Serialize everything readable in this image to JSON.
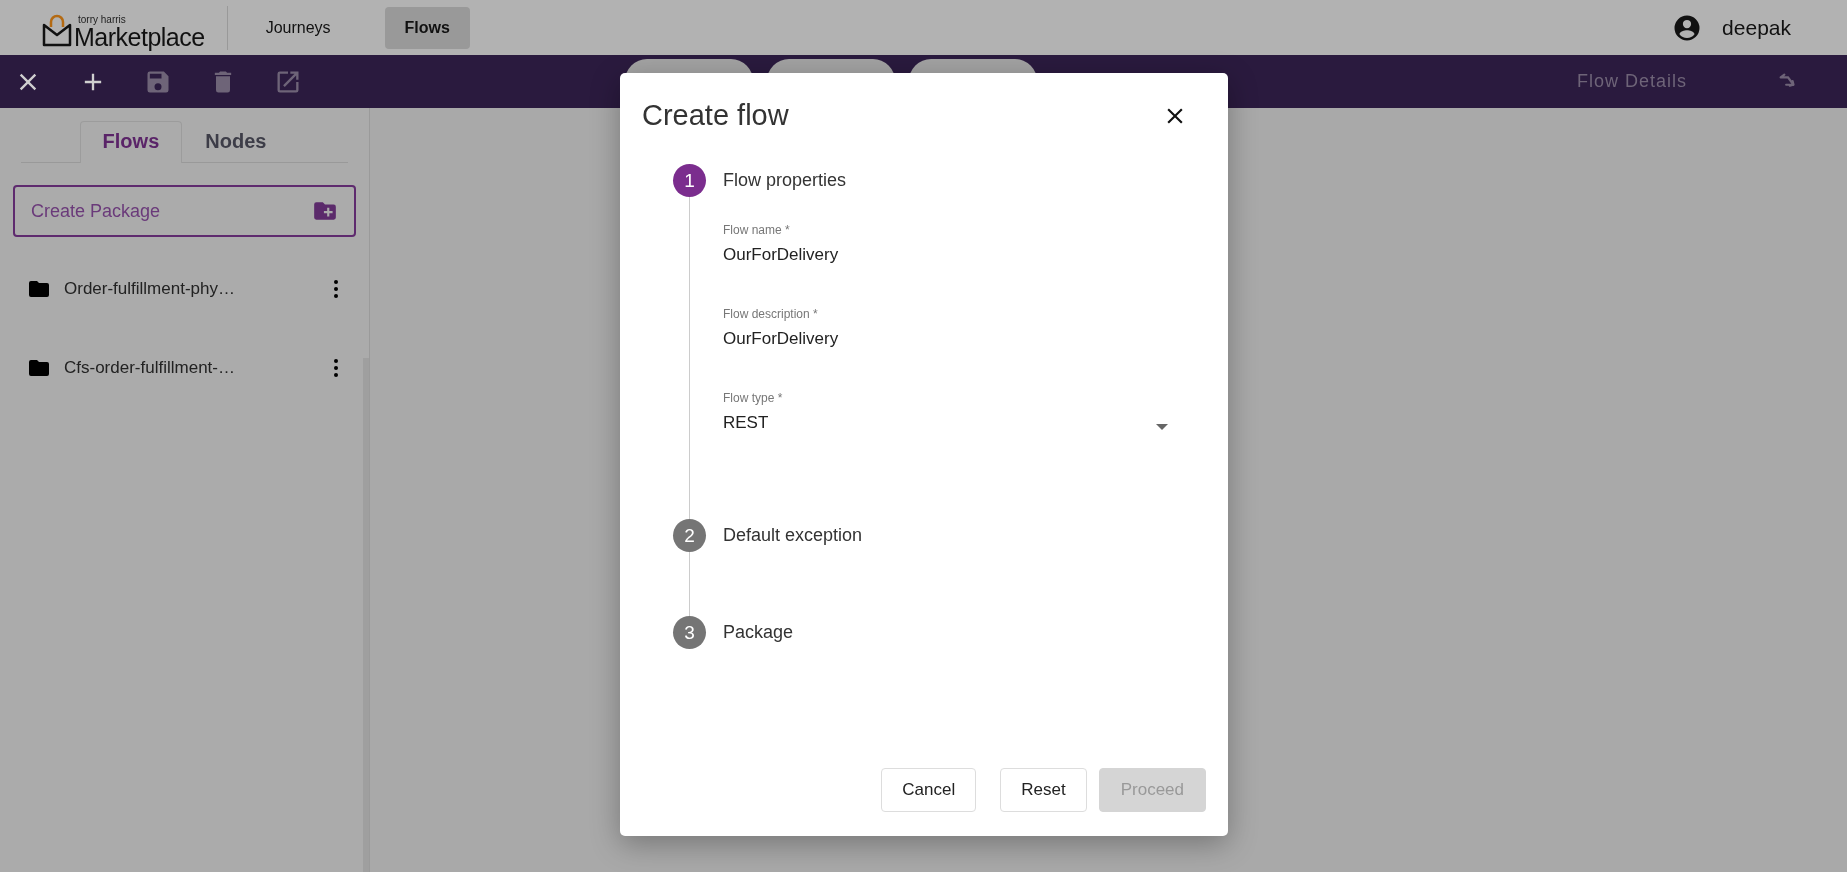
{
  "header": {
    "logo": {
      "tagline": "torry harris",
      "brand": "Marketplace"
    },
    "nav": [
      {
        "label": "Journeys",
        "selected": false
      },
      {
        "label": "Flows",
        "selected": true
      }
    ],
    "user": {
      "name": "deepak"
    }
  },
  "toolbar": {
    "actions": [
      {
        "kind": "close",
        "disabled": false
      },
      {
        "kind": "add",
        "disabled": false
      },
      {
        "kind": "save",
        "disabled": true
      },
      {
        "kind": "delete",
        "disabled": true
      },
      {
        "kind": "open",
        "disabled": true
      }
    ],
    "details_label": "Flow Details"
  },
  "sidebar": {
    "tabs": [
      {
        "label": "Flows",
        "selected": true
      },
      {
        "label": "Nodes",
        "selected": false
      }
    ],
    "create_button": "Create Package",
    "packages": [
      {
        "name": "Order-fulfillment-phy…"
      },
      {
        "name": "Cfs-order-fulfillment-…"
      }
    ]
  },
  "dialog": {
    "title": "Create flow",
    "steps": [
      {
        "number": "1",
        "label": "Flow properties",
        "active": true,
        "fields": [
          {
            "kind": "text",
            "label": "Flow name *",
            "value": "OurForDelivery"
          },
          {
            "kind": "text",
            "label": "Flow description *",
            "value": "OurForDelivery"
          },
          {
            "kind": "select",
            "label": "Flow type *",
            "value": "REST"
          }
        ]
      },
      {
        "number": "2",
        "label": "Default exception",
        "active": false
      },
      {
        "number": "3",
        "label": "Package",
        "active": false
      }
    ],
    "buttons": [
      {
        "label": "Cancel",
        "disabled": false
      },
      {
        "label": "Reset",
        "disabled": false
      },
      {
        "label": "Proceed",
        "disabled": true
      }
    ]
  }
}
